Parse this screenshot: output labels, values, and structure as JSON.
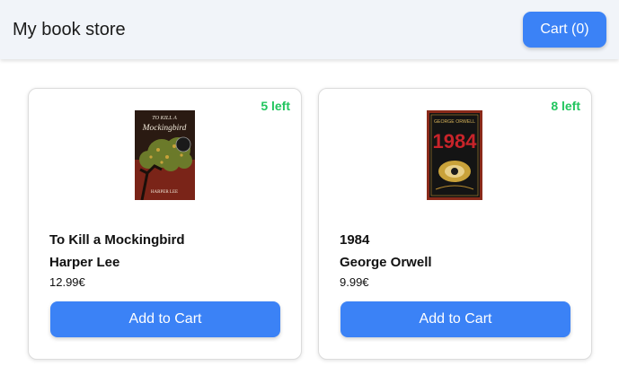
{
  "header": {
    "title": "My book store",
    "cart_label": "Cart (0)"
  },
  "colors": {
    "accent": "#3b82f6",
    "stock": "#22c55e",
    "header_bg": "#f1f4f9"
  },
  "products": [
    {
      "stock": "5 left",
      "cover_text": [
        "TO KILL A",
        "Mockingbird",
        "HARPER LEE"
      ],
      "title": "To Kill a Mockingbird",
      "author": "Harper Lee",
      "price": "12.99€",
      "button": "Add to Cart"
    },
    {
      "stock": "8 left",
      "cover_text": [
        "GEORGE ORWELL",
        "1984"
      ],
      "title": "1984",
      "author": "George Orwell",
      "price": "9.99€",
      "button": "Add to Cart"
    }
  ]
}
